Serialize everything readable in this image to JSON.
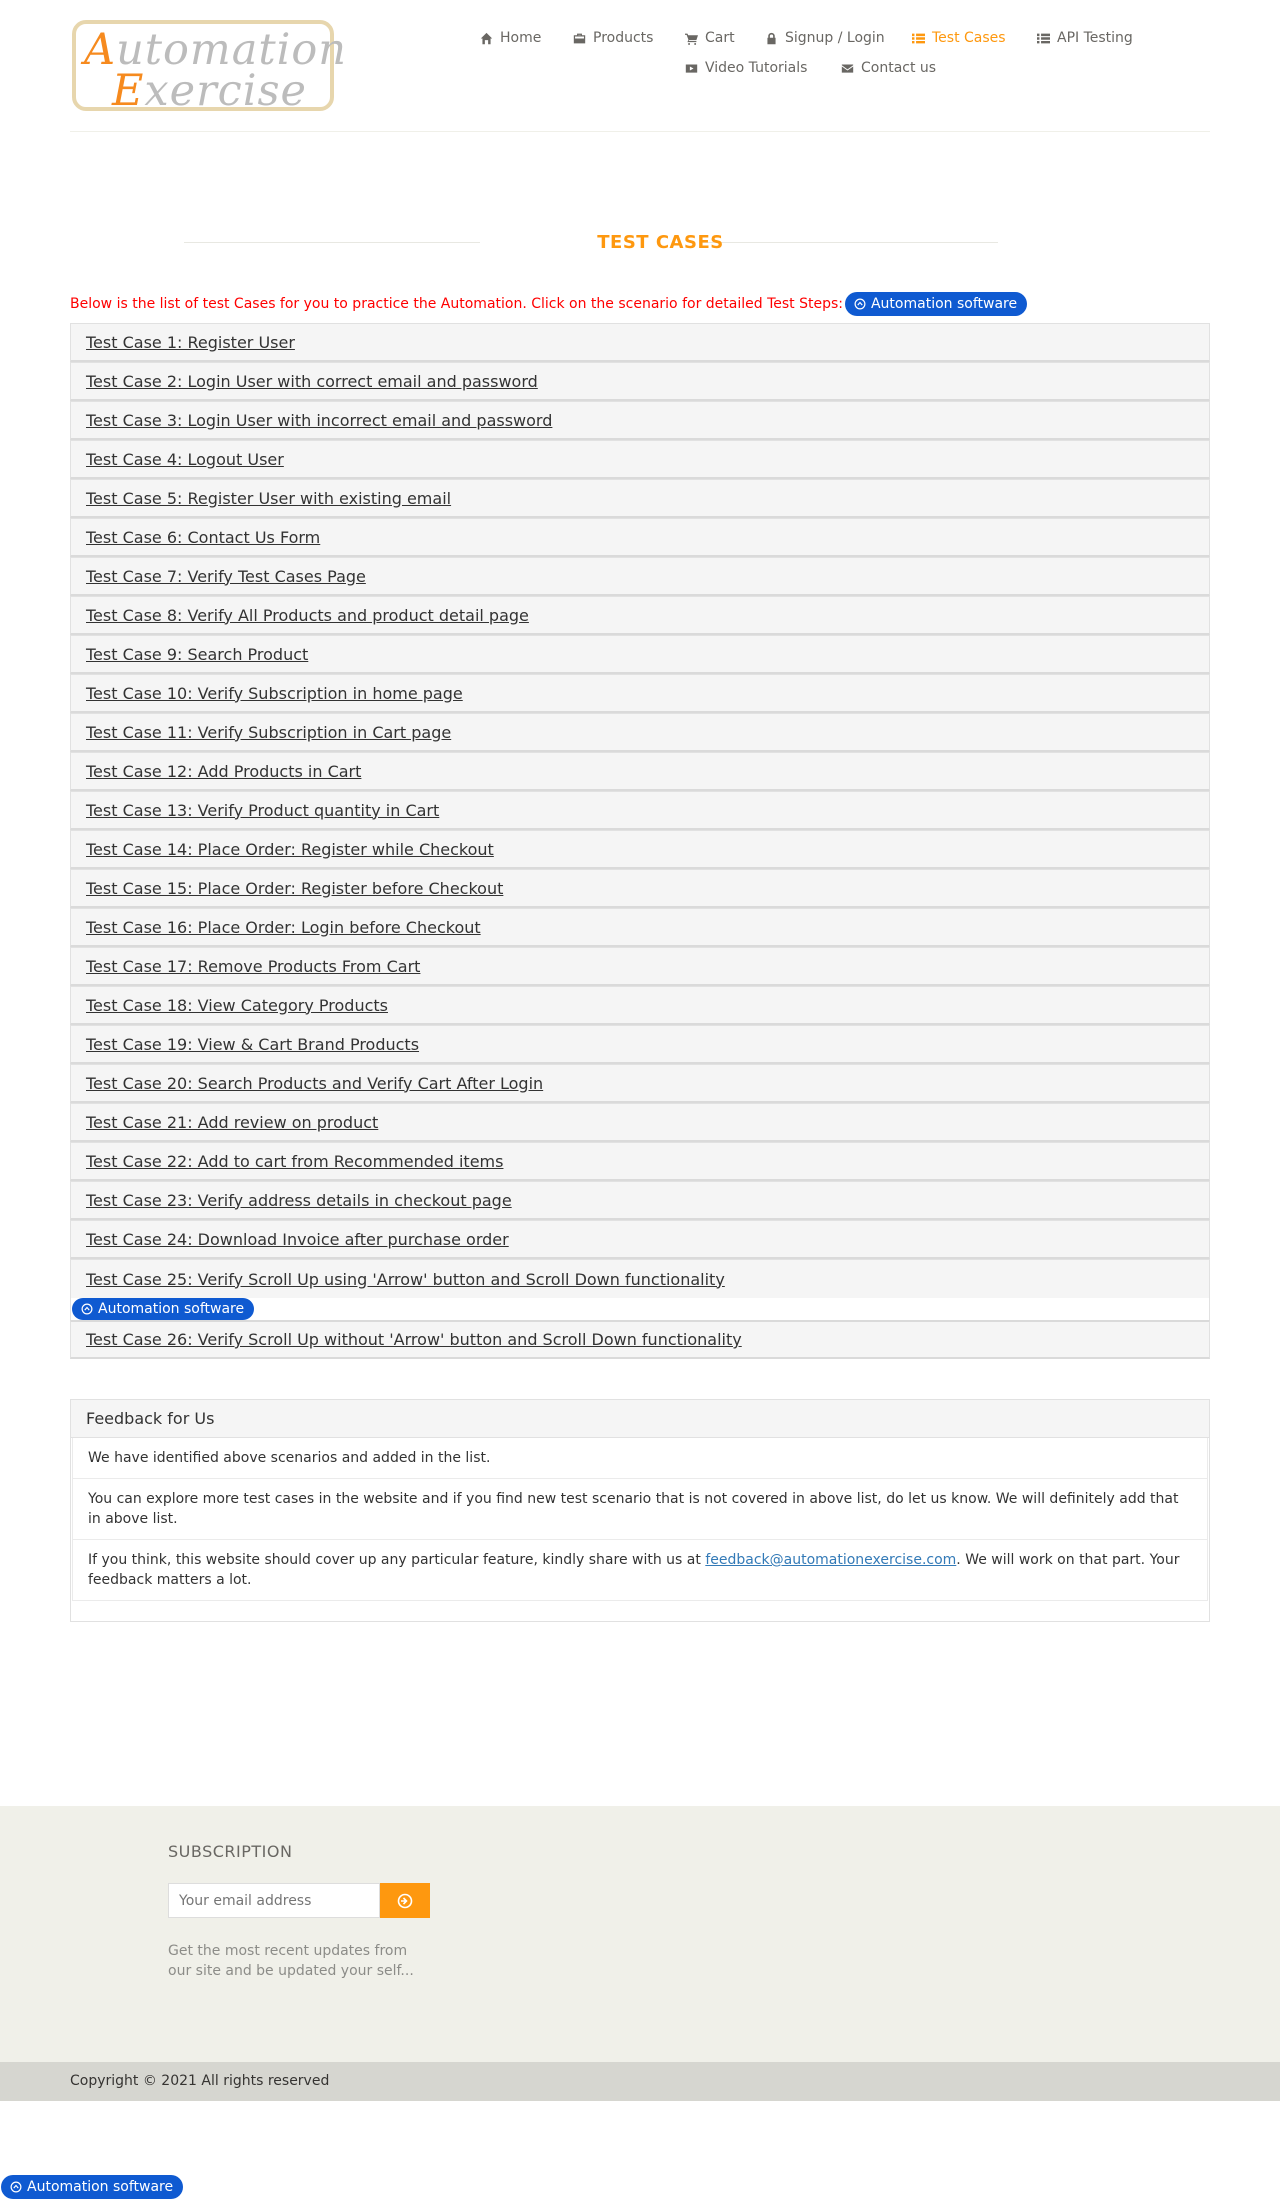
{
  "header": {
    "logo": {
      "line1_cap": "A",
      "line1_rest": "utomation",
      "line2_cap": "E",
      "line2_rest": "xercise"
    },
    "nav": [
      {
        "label": "Home",
        "icon": "home-icon"
      },
      {
        "label": "Products",
        "icon": "products-icon"
      },
      {
        "label": "Cart",
        "icon": "cart-icon"
      },
      {
        "label": "Signup / Login",
        "icon": "lock-icon"
      },
      {
        "label": "Test Cases",
        "icon": "list-icon",
        "active": true
      },
      {
        "label": "API Testing",
        "icon": "list-icon"
      },
      {
        "label": "Video Tutorials",
        "icon": "youtube-icon"
      },
      {
        "label": "Contact us",
        "icon": "envelope-icon"
      }
    ]
  },
  "main": {
    "title": "TEST CASES",
    "intro": "Below is the list of test Cases for you to practice the Automation. Click on the scenario for detailed Test Steps:",
    "ad_label": "Automation software",
    "cases": [
      "Test Case 1: Register User",
      "Test Case 2: Login User with correct email and password",
      "Test Case 3: Login User with incorrect email and password",
      "Test Case 4: Logout User",
      "Test Case 5: Register User with existing email",
      "Test Case 6: Contact Us Form",
      "Test Case 7: Verify Test Cases Page",
      "Test Case 8: Verify All Products and product detail page",
      "Test Case 9: Search Product",
      "Test Case 10: Verify Subscription in home page",
      "Test Case 11: Verify Subscription in Cart page",
      "Test Case 12: Add Products in Cart",
      "Test Case 13: Verify Product quantity in Cart",
      "Test Case 14: Place Order: Register while Checkout",
      "Test Case 15: Place Order: Register before Checkout",
      "Test Case 16: Place Order: Login before Checkout",
      "Test Case 17: Remove Products From Cart",
      "Test Case 18: View Category Products",
      "Test Case 19: View & Cart Brand Products",
      "Test Case 20: Search Products and Verify Cart After Login",
      "Test Case 21: Add review on product",
      "Test Case 22: Add to cart from Recommended items",
      "Test Case 23: Verify address details in checkout page",
      "Test Case 24: Download Invoice after purchase order",
      "Test Case 25: Verify Scroll Up using 'Arrow' button and Scroll Down functionality",
      "Test Case 26: Verify Scroll Up without 'Arrow' button and Scroll Down functionality"
    ]
  },
  "feedback": {
    "heading": "Feedback for Us",
    "item1": "We have identified above scenarios and added in the list.",
    "item2": "You can explore more test cases in the website and if you find new test scenario that is not covered in above list, do let us know. We will definitely add that in above list.",
    "item3_before": "If you think, this website should cover up any particular feature, kindly share with us at ",
    "item3_email": "feedback@automationexercise.com",
    "item3_after": ". We will work on that part. Your feedback matters a lot."
  },
  "footer": {
    "subscription_title": "SUBSCRIPTION",
    "email_placeholder": "Your email address",
    "subscription_desc": "Get the most recent updates from our site and be updated your self...",
    "copyright": "Copyright © 2021 All rights reserved"
  },
  "colors": {
    "accent": "#fe980f",
    "ad_blue": "#0f5ad1",
    "intro_red": "#ff0000"
  }
}
